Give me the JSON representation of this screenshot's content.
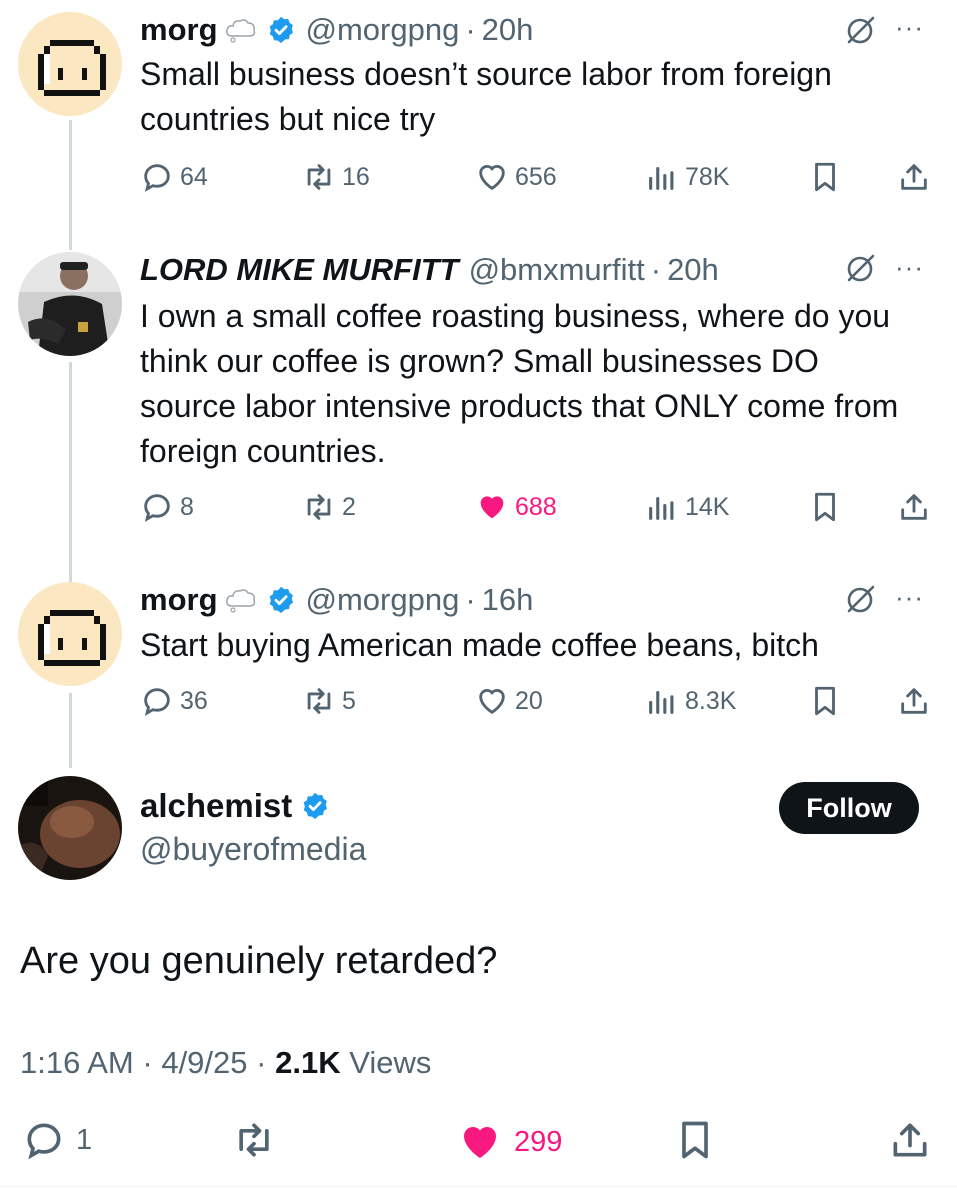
{
  "colors": {
    "accent_blue": "#1d9bf0",
    "like_pink": "#f91880",
    "muted": "#536471",
    "text": "#0f1419"
  },
  "replies": [
    {
      "name": "morg",
      "handle": "@morgpng",
      "time": "20h",
      "text": "Small business doesn’t source labor from foreign countries but nice try",
      "replies": "64",
      "reposts": "16",
      "likes": "656",
      "views": "78K",
      "liked": false
    },
    {
      "name": "LORD MIKE MURFITT",
      "handle": "@bmxmurfitt",
      "time": "20h",
      "text": "I own a small coffee roasting business, where do you think our coffee is grown? Small businesses DO source labor intensive products that ONLY come from foreign countries.",
      "replies": "8",
      "reposts": "2",
      "likes": "688",
      "views": "14K",
      "liked": true
    },
    {
      "name": "morg",
      "handle": "@morgpng",
      "time": "16h",
      "text": "Start buying American made coffee beans, bitch",
      "replies": "36",
      "reposts": "5",
      "likes": "20",
      "views": "8.3K",
      "liked": false
    }
  ],
  "main": {
    "name": "alchemist",
    "handle": "@buyerofmedia",
    "follow_label": "Follow",
    "text": "Are you genuinely retarded?",
    "time": "1:16 AM",
    "date": "4/9/25",
    "views_count": "2.1K",
    "views_label": "Views",
    "replies": "1",
    "likes": "299"
  },
  "separator": "·",
  "more_label": "···"
}
